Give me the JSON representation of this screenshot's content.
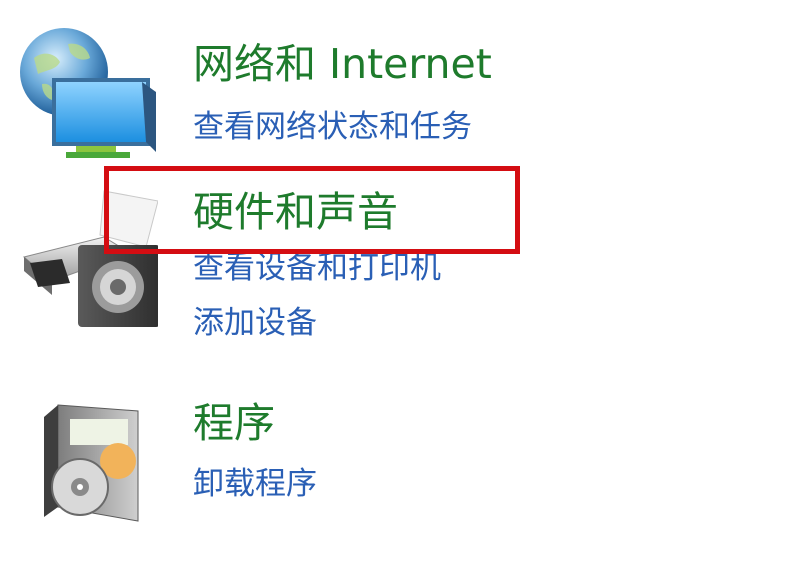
{
  "categories": [
    {
      "icon": "network-globe-monitor-icon",
      "title": "网络和 Internet",
      "links": [
        "查看网络状态和任务"
      ]
    },
    {
      "icon": "printer-speaker-icon",
      "title": "硬件和声音",
      "links": [
        "查看设备和打印机",
        "添加设备"
      ]
    },
    {
      "icon": "program-disc-box-icon",
      "title": "程序",
      "links": [
        "卸载程序"
      ]
    }
  ],
  "colors": {
    "title": "#1e7b2c",
    "link": "#2a5fb5",
    "highlight": "#d40d12"
  }
}
